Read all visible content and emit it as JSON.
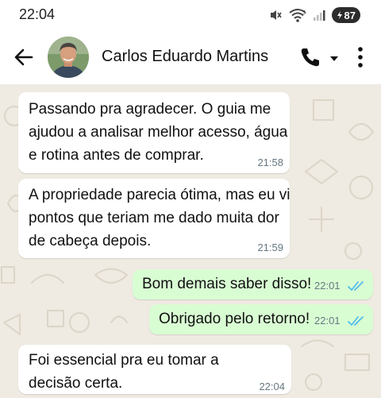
{
  "status_bar": {
    "time": "22:04",
    "battery": "87",
    "icons": [
      "mute-icon",
      "wifi-icon",
      "signal-icon",
      "battery-icon"
    ]
  },
  "header": {
    "contact_name": "Carlos Eduardo Martins",
    "icons": [
      "back-arrow-icon",
      "avatar",
      "phone-icon",
      "chevron-down-icon",
      "more-vert-icon"
    ]
  },
  "messages": [
    {
      "direction": "incoming",
      "text": "Passando pra agradecer. O guia me ajudou a analisar melhor acesso, água e rotina antes de comprar.",
      "time": "21:58"
    },
    {
      "direction": "incoming",
      "text": "A propriedade parecia ótima, mas eu vi pontos que teriam me dado muita dor de cabeça depois.",
      "time": "21:59"
    },
    {
      "direction": "outgoing",
      "text": "Bom demais saber disso!",
      "time": "22:01",
      "status": "read"
    },
    {
      "direction": "outgoing",
      "text": "Obrigado pelo retorno!",
      "time": "22:01",
      "status": "read"
    },
    {
      "direction": "incoming",
      "text": "Foi essencial pra eu tomar a decisão certa.",
      "time": "22:04"
    }
  ],
  "colors": {
    "chat_background": "#efeae2",
    "incoming_bubble": "#ffffff",
    "outgoing_bubble": "#d9fdd3",
    "read_ticks": "#53bdeb",
    "timestamp": "#667781"
  }
}
